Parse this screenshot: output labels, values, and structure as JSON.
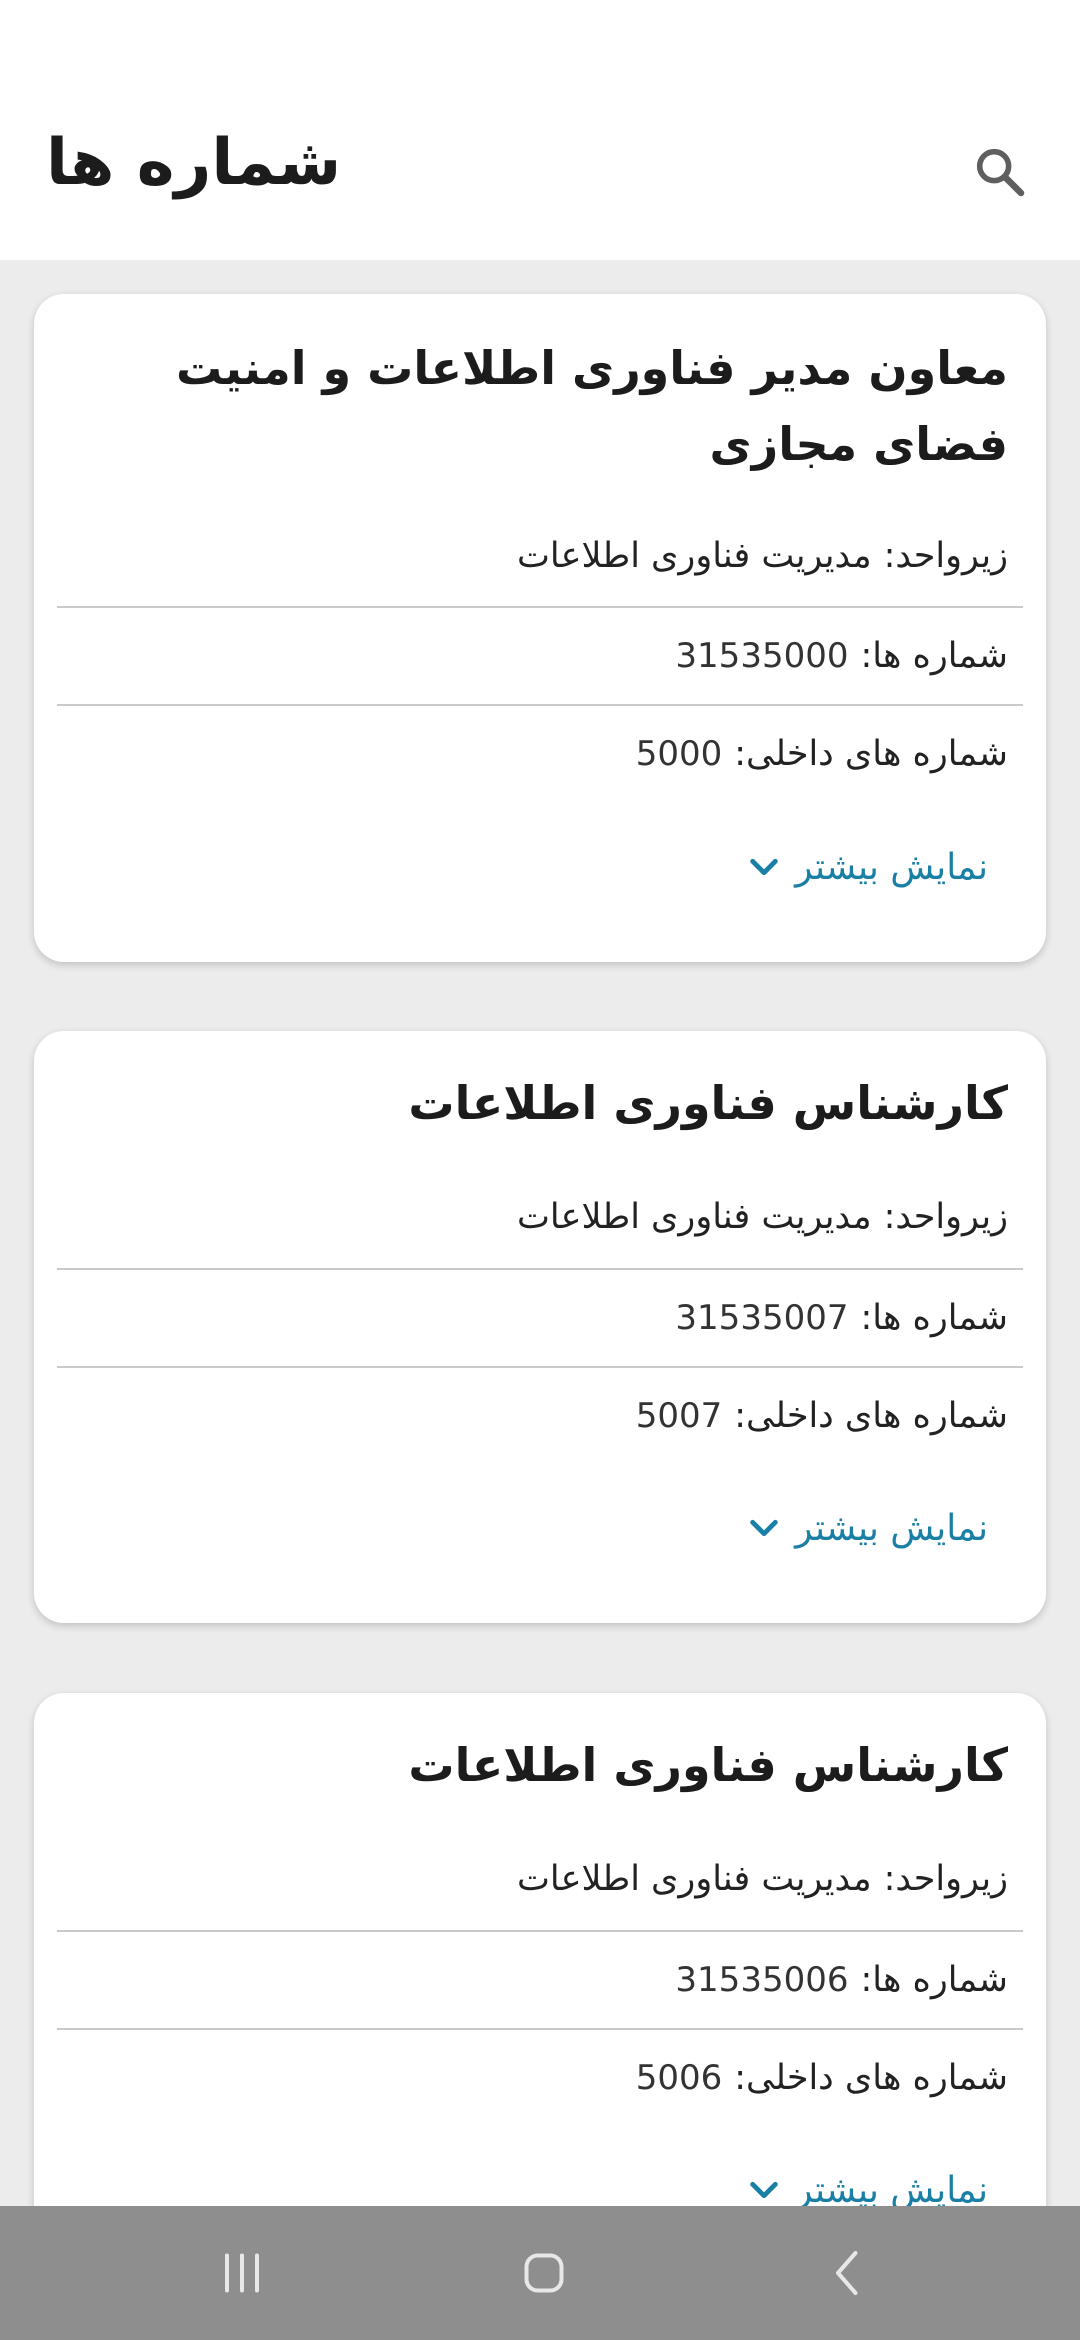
{
  "header": {
    "title": "شماره ها",
    "search_icon": "search-icon"
  },
  "cards": [
    {
      "title": "معاون مدیر فناوری اطلاعات و امنیت فضای مجازی",
      "subunit_label": "زیرواحد:",
      "subunit_value": "مدیریت فناوری اطلاعات",
      "numbers_label": "شماره ها:",
      "numbers_value": "31535000",
      "internal_label": "شماره های داخلی:",
      "internal_value": "5000",
      "more_label": "نمایش بیشتر"
    },
    {
      "title": "کارشناس فناوری اطلاعات",
      "subunit_label": "زیرواحد:",
      "subunit_value": "مدیریت فناوری اطلاعات",
      "numbers_label": "شماره ها:",
      "numbers_value": "31535007",
      "internal_label": "شماره های داخلی:",
      "internal_value": "5007",
      "more_label": "نمایش بیشتر"
    },
    {
      "title": "کارشناس فناوری اطلاعات",
      "subunit_label": "زیرواحد:",
      "subunit_value": "مدیریت فناوری اطلاعات",
      "numbers_label": "شماره ها:",
      "numbers_value": "31535006",
      "internal_label": "شماره های داخلی:",
      "internal_value": "5006",
      "more_label": "نمایش بیشتر"
    }
  ],
  "nav": {
    "recents_icon": "recents-icon",
    "home_icon": "home-icon",
    "back_icon": "back-icon"
  },
  "colors": {
    "accent": "#1a7fa5",
    "background": "#ececec",
    "card": "#ffffff",
    "nav_bar": "#8e8e8e"
  }
}
